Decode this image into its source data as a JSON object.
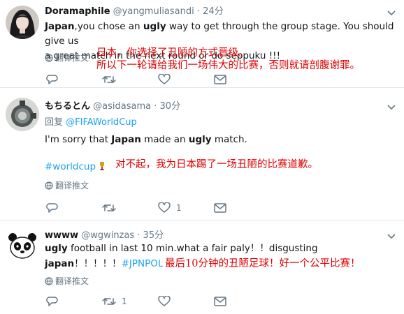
{
  "tweets": [
    {
      "name": "Doramaphile",
      "handle": "@yangmuliasandi",
      "separator": "·",
      "time": "24分",
      "text": {
        "line1": [
          {
            "t": "Japan",
            "bold": true
          },
          {
            "t": ",you chose an ",
            "bold": false
          },
          {
            "t": "ugly",
            "bold": true
          },
          {
            "t": " way to get through the group stage. You should give us",
            "bold": false
          }
        ],
        "line2": "a great match in the next round or do seppuku !!!"
      },
      "translate_label": "翻译推文",
      "annotation_lines": [
        "日本，你选择了丑陋的方式晋级。",
        "所以下一轮请给我们一场伟大的比赛，否则就请剖腹谢罪。"
      ],
      "actions": {
        "reply": "",
        "retweet": "",
        "like": "",
        "dm": ""
      }
    },
    {
      "name": "もちるとん",
      "handle": "@asidasama",
      "separator": "·",
      "time": "30分",
      "reply_prefix": "回复",
      "reply_to": "@FIFAWorldCup",
      "text": [
        {
          "t": "I'm sorry that ",
          "bold": false
        },
        {
          "t": "Japan",
          "bold": true
        },
        {
          "t": " made an ",
          "bold": false
        },
        {
          "t": "ugly",
          "bold": true
        },
        {
          "t": " match.",
          "bold": false
        }
      ],
      "hashtag": "#worldcup",
      "translate_label": "翻译推文",
      "annotation_lines": [
        "对不起，我为日本踢了一场丑陋的比赛道歉。"
      ],
      "actions": {
        "reply": "",
        "retweet": "",
        "like": "1",
        "dm": ""
      }
    },
    {
      "name": "wwww",
      "handle": "@wgwinzas",
      "separator": "·",
      "time": "35分",
      "line1": [
        {
          "t": "ugly",
          "bold": true
        },
        {
          "t": " football in last 10 min.what a fair paly！！disgusting",
          "bold": false
        }
      ],
      "line2_bold": "japan",
      "line2_marks": "！！！！！",
      "hashtag": "#JPNPOL",
      "translate_label": "翻译推文",
      "annotation_lines": [
        "最后10分钟的丑陋足球！好一个公平比赛！"
      ],
      "actions": {
        "reply": "",
        "retweet": "1",
        "like": "",
        "dm": ""
      }
    }
  ],
  "colors": {
    "text": "#14171a",
    "muted": "#657786",
    "link": "#1da1f2",
    "annotation": "#e00000",
    "divider": "#e1e8ed"
  }
}
